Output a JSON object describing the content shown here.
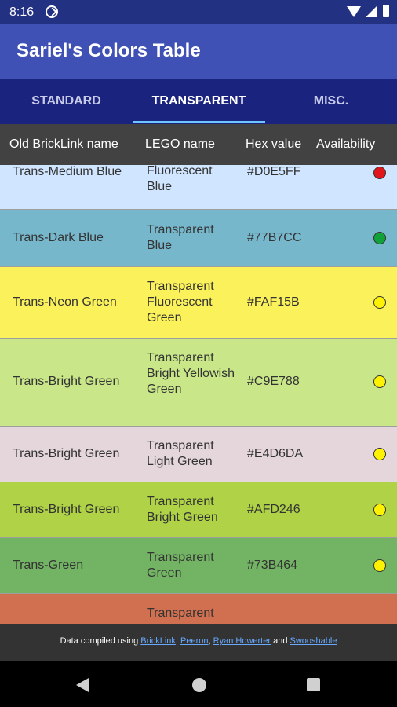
{
  "status_bar": {
    "time": "8:16"
  },
  "app": {
    "title": "Sariel's Colors Table"
  },
  "tabs": [
    {
      "label": "STANDARD"
    },
    {
      "label": "TRANSPARENT"
    },
    {
      "label": "MISC."
    }
  ],
  "table": {
    "headers": {
      "old_name": "Old BrickLink name",
      "lego_name": "LEGO name",
      "hex": "Hex value",
      "availability": "Availability"
    },
    "rows": [
      {
        "old": "Trans-Medium Blue",
        "lego": "Fluorescent Blue",
        "hex": "#D0E5FF",
        "bg": "#D0E5FF",
        "availability_color": "#E0161B"
      },
      {
        "old": "Trans-Dark Blue",
        "lego": "Transparent Blue",
        "hex": "#77B7CC",
        "bg": "#77B7CC",
        "availability_color": "#11A13A"
      },
      {
        "old": "Trans-Neon Green",
        "lego": "Transparent Fluorescent Green",
        "hex": "#FAF15B",
        "bg": "#FAF15B",
        "availability_color": "#FFF200"
      },
      {
        "old": "Trans-Bright Green",
        "lego": "Transparent Bright Yellowish Green",
        "hex": "#C9E788",
        "bg": "#C9E788",
        "availability_color": "#FFF200"
      },
      {
        "old": "Trans-Bright Green",
        "lego": "Transparent Light Green",
        "hex": "#E4D6DA",
        "bg": "#E4D6DA",
        "availability_color": "#FFF200"
      },
      {
        "old": "Trans-Bright Green",
        "lego": "Transparent Bright Green",
        "hex": "#AFD246",
        "bg": "#AFD246",
        "availability_color": "#FFF200"
      },
      {
        "old": "Trans-Green",
        "lego": "Transparent Green",
        "hex": "#73B464",
        "bg": "#73B464",
        "availability_color": "#FFF200"
      },
      {
        "old": "",
        "lego": "Transparent",
        "hex": "",
        "bg": "#D07050",
        "availability_color": ""
      }
    ]
  },
  "footer": {
    "prefix": "Data compiled using",
    "link1": "BrickLink",
    "sep1": ",",
    "link2": "Peeron",
    "sep2": ",",
    "link3": "Ryan Howerter",
    "and": "and",
    "link4": "Swooshable"
  }
}
